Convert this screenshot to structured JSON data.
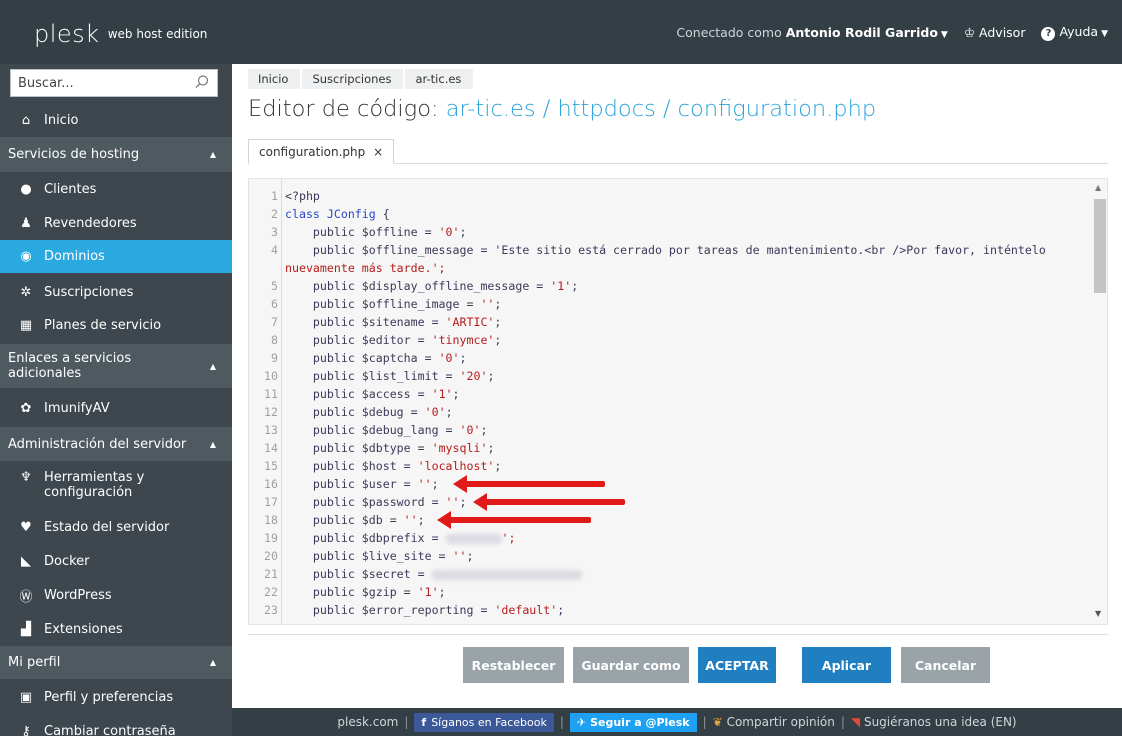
{
  "header": {
    "logo": "plesk",
    "edition": "web host edition",
    "connected_as_label": "Conectado como",
    "user_name": "Antonio Rodil Garrido",
    "advisor": "Advisor",
    "help": "Ayuda"
  },
  "sidebar": {
    "search_placeholder": "Buscar...",
    "home": "Inicio",
    "sections": {
      "hosting": "Servicios de hosting",
      "links": "Enlaces a servicios adicionales",
      "server_admin": "Administración del servidor",
      "profile": "Mi perfil"
    },
    "items": {
      "clients": "Clientes",
      "resellers": "Revendedores",
      "domains": "Dominios",
      "subscriptions": "Suscripciones",
      "service_plans": "Planes de servicio",
      "imunifyav": "ImunifyAV",
      "tools": "Herramientas y configuración",
      "server_status": "Estado del servidor",
      "docker": "Docker",
      "wordpress": "WordPress",
      "extensions": "Extensiones",
      "profile_prefs": "Perfil y preferencias",
      "change_password": "Cambiar contraseña"
    },
    "active_color": "#2aa9e0"
  },
  "breadcrumbs": [
    "Inicio",
    "Suscripciones",
    "ar-tic.es"
  ],
  "page": {
    "title_prefix": "Editor de código:",
    "title_path": "ar-tic.es / httpdocs / configuration.php",
    "tab_label": "configuration.php",
    "tab_close": "×"
  },
  "code": {
    "line_numbers": [
      "1",
      "2",
      "3",
      "4",
      "",
      "5",
      "6",
      "7",
      "8",
      "9",
      "10",
      "11",
      "12",
      "13",
      "14",
      "15",
      "16",
      "17",
      "18",
      "19",
      "20",
      "21",
      "22",
      "23"
    ],
    "lines": [
      "<?php",
      "class JConfig {",
      "    public $offline = '0';",
      "    public $offline_message = 'Este sitio está cerrado por tareas de mantenimiento.<br />Por favor, inténtelo",
      "nuevamente más tarde.';",
      "    public $display_offline_message = '1';",
      "    public $offline_image = '';",
      "    public $sitename = 'ARTIC';",
      "    public $editor = 'tinymce';",
      "    public $captcha = '0';",
      "    public $list_limit = '20';",
      "    public $access = '1';",
      "    public $debug = '0';",
      "    public $debug_lang = '0';",
      "    public $dbtype = 'mysqli';",
      "    public $host = 'localhost';",
      "    public $user = '';",
      "    public $password = '';",
      "    public $db = '';",
      "    public $dbprefix = ",
      "    public $live_site = '';",
      "    public $secret = ",
      "    public $gzip = '1';",
      "    public $error_reporting = 'default';"
    ]
  },
  "buttons": {
    "reset": "Restablecer",
    "save_as": "Guardar como",
    "ok": "ACEPTAR",
    "apply": "Aplicar",
    "cancel": "Cancelar"
  },
  "footer": {
    "site": "plesk.com",
    "facebook": "Síganos en Facebook",
    "twitter": "Seguir a @Plesk",
    "share": "Compartir opinión",
    "suggest": "Sugiéranos una idea (EN)"
  }
}
